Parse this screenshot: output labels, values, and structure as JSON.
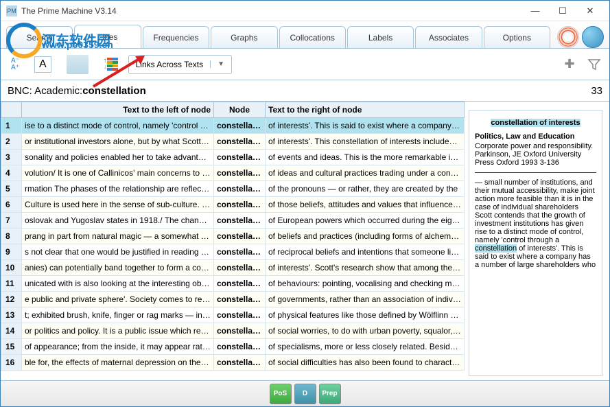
{
  "window": {
    "title": "The Prime Machine V3.14",
    "min": "—",
    "max": "☐",
    "close": "✕"
  },
  "watermark": {
    "text": "河东软件园",
    "url": "www.pc0359.cn"
  },
  "tabs": [
    "Search",
    "Lines",
    "Frequencies",
    "Graphs",
    "Collocations",
    "Labels",
    "Associates",
    "Options"
  ],
  "activeTab": 1,
  "toolbar": {
    "fontsize_small": "A⁻",
    "fontsize_large": "A⁺",
    "dropdown_label": "Links Across Texts",
    "dropdown_arrow": "▼"
  },
  "header": {
    "corpus": "BNC: Academic: ",
    "term": "constellation",
    "count": "33"
  },
  "columns": {
    "num": "",
    "left": "Text to the left of node",
    "node": "Node",
    "right": "Text to the right of node"
  },
  "rows": [
    {
      "n": "1",
      "left": "ise to a distinct mode of control, namely 'control through a `",
      "node": "constellation",
      "right": "of interests'. This is said to exist where a company has",
      "sel": true
    },
    {
      "n": "2",
      "left": "or institutional investors alone, but by what Scott calls a `",
      "node": "constellation",
      "right": "of interests'. This constellation of interests includes ent"
    },
    {
      "n": "3",
      "left": "sonality and policies enabled her to take advantage of the",
      "node": "constellation",
      "right": "of events and ideas. This is the more remarkable in vie"
    },
    {
      "n": "4",
      "left": "volution/ It is one of Callinicos' main concerns to relate the",
      "node": "constellation",
      "right": "of ideas and cultural practices trading under a concept"
    },
    {
      "n": "5",
      "left": "rmation The phases of the relationship are reflected in the",
      "node": "constellation",
      "right": "of the pronouns — or rather, they are created by the"
    },
    {
      "n": "6",
      "left": "Culture is used here in the sense of sub-culture. It is the",
      "node": "constellation",
      "right": "of those beliefs, attitudes and values that influence su"
    },
    {
      "n": "7",
      "left": "oslovak and Yugoslav states in 1918./ The changes in the",
      "node": "constellation",
      "right": "of European powers which occurred during the eightee"
    },
    {
      "n": "8",
      "left": "prang in part from natural magic — a somewhat disparate",
      "node": "constellation",
      "right": "of beliefs and practices (including forms of alchemy and"
    },
    {
      "n": "9",
      "left": "s not clear that one would be justified in reading into it the",
      "node": "constellation",
      "right": "of reciprocal beliefs and intentions that someone like Le"
    },
    {
      "n": "10",
      "left": "anies) can potentially band together to form a controlling `",
      "node": "constellation",
      "right": "of interests'. Scott's research show that among the top"
    },
    {
      "n": "11",
      "left": "unicated with is also looking at the interesting object. The",
      "node": "constellation",
      "right": "of behaviours: pointing, vocalising and checking may b"
    },
    {
      "n": "12",
      "left": "e public and private sphere'. Society comes to resemble 'a",
      "node": "constellation",
      "right": "of governments, rather than an association of individu"
    },
    {
      "n": "13",
      "left": "t; exhibited brush, knife, finger or rag marks — in short a",
      "node": "constellation",
      "right": "of physical features like those defined by Wölflinn whe"
    },
    {
      "n": "14",
      "left": "or politics and policy. It is a public issue which represents a",
      "node": "constellation",
      "right": "of social worries, to do with urban poverty, squalor, ill-"
    },
    {
      "n": "15",
      "left": "of appearance; from the inside, it may appear rather as a",
      "node": "constellation",
      "right": "of specialisms, more or less closely related. Besides, do"
    },
    {
      "n": "16",
      "left": "ble for, the effects of maternal depression on the child / A",
      "node": "constellation",
      "right": "of social difficulties has also been found to characterise"
    }
  ],
  "side": {
    "title_pre": "constellation",
    "title_post": " of interests",
    "topic": "Politics, Law and Education",
    "meta": "Corporate power and responsibility. Parkinson, JE Oxford University Press Oxford 1993 3-136",
    "body_pre": "— small number of institutions, and their mutual accessibility, make joint action more feasible than it is in the case of individual shareholders Scott contends that the growth of investment institutions has given rise to a distinct mode of control, namely 'control through a ",
    "body_hl": "constellation",
    "body_post": " of interests'. This is said to exist where a company has a number of large shareholders who"
  },
  "bottom": {
    "pos": "PoS",
    "d": "D",
    "prep": "Prep"
  }
}
